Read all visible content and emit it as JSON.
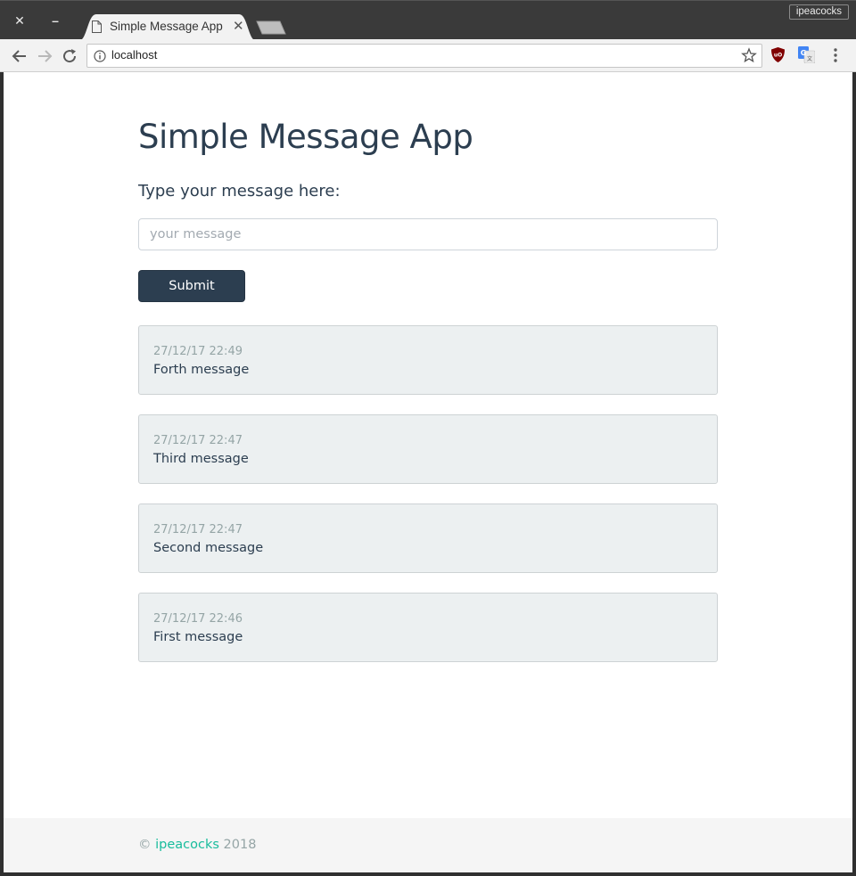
{
  "browser": {
    "tab_title": "Simple Message App",
    "tab_close": "✕",
    "window_close": "✕",
    "window_minimize": "–",
    "profile_name": "ipeacocks",
    "url": "localhost",
    "icons": [
      "close-icon",
      "minimize-icon",
      "document-icon",
      "back-icon",
      "forward-icon",
      "reload-icon",
      "info-icon",
      "star-icon",
      "ublock-icon",
      "translate-icon",
      "menu-icon"
    ]
  },
  "page": {
    "title": "Simple Message App",
    "form_label": "Type your message here:",
    "input_value": "",
    "input_placeholder": "your message",
    "submit_label": "Submit",
    "messages": [
      {
        "time": "27/12/17 22:49",
        "text": "Forth message"
      },
      {
        "time": "27/12/17 22:47",
        "text": "Third message"
      },
      {
        "time": "27/12/17 22:47",
        "text": "Second message"
      },
      {
        "time": "27/12/17 22:46",
        "text": "First message"
      }
    ],
    "footer": {
      "copyright": "©",
      "author_link": "ipeacocks",
      "year": "2018"
    }
  },
  "colors": {
    "primary": "#2c3e50",
    "accent": "#18bc9c",
    "muted": "#95a5a6",
    "card_bg": "#ecf0f1"
  }
}
